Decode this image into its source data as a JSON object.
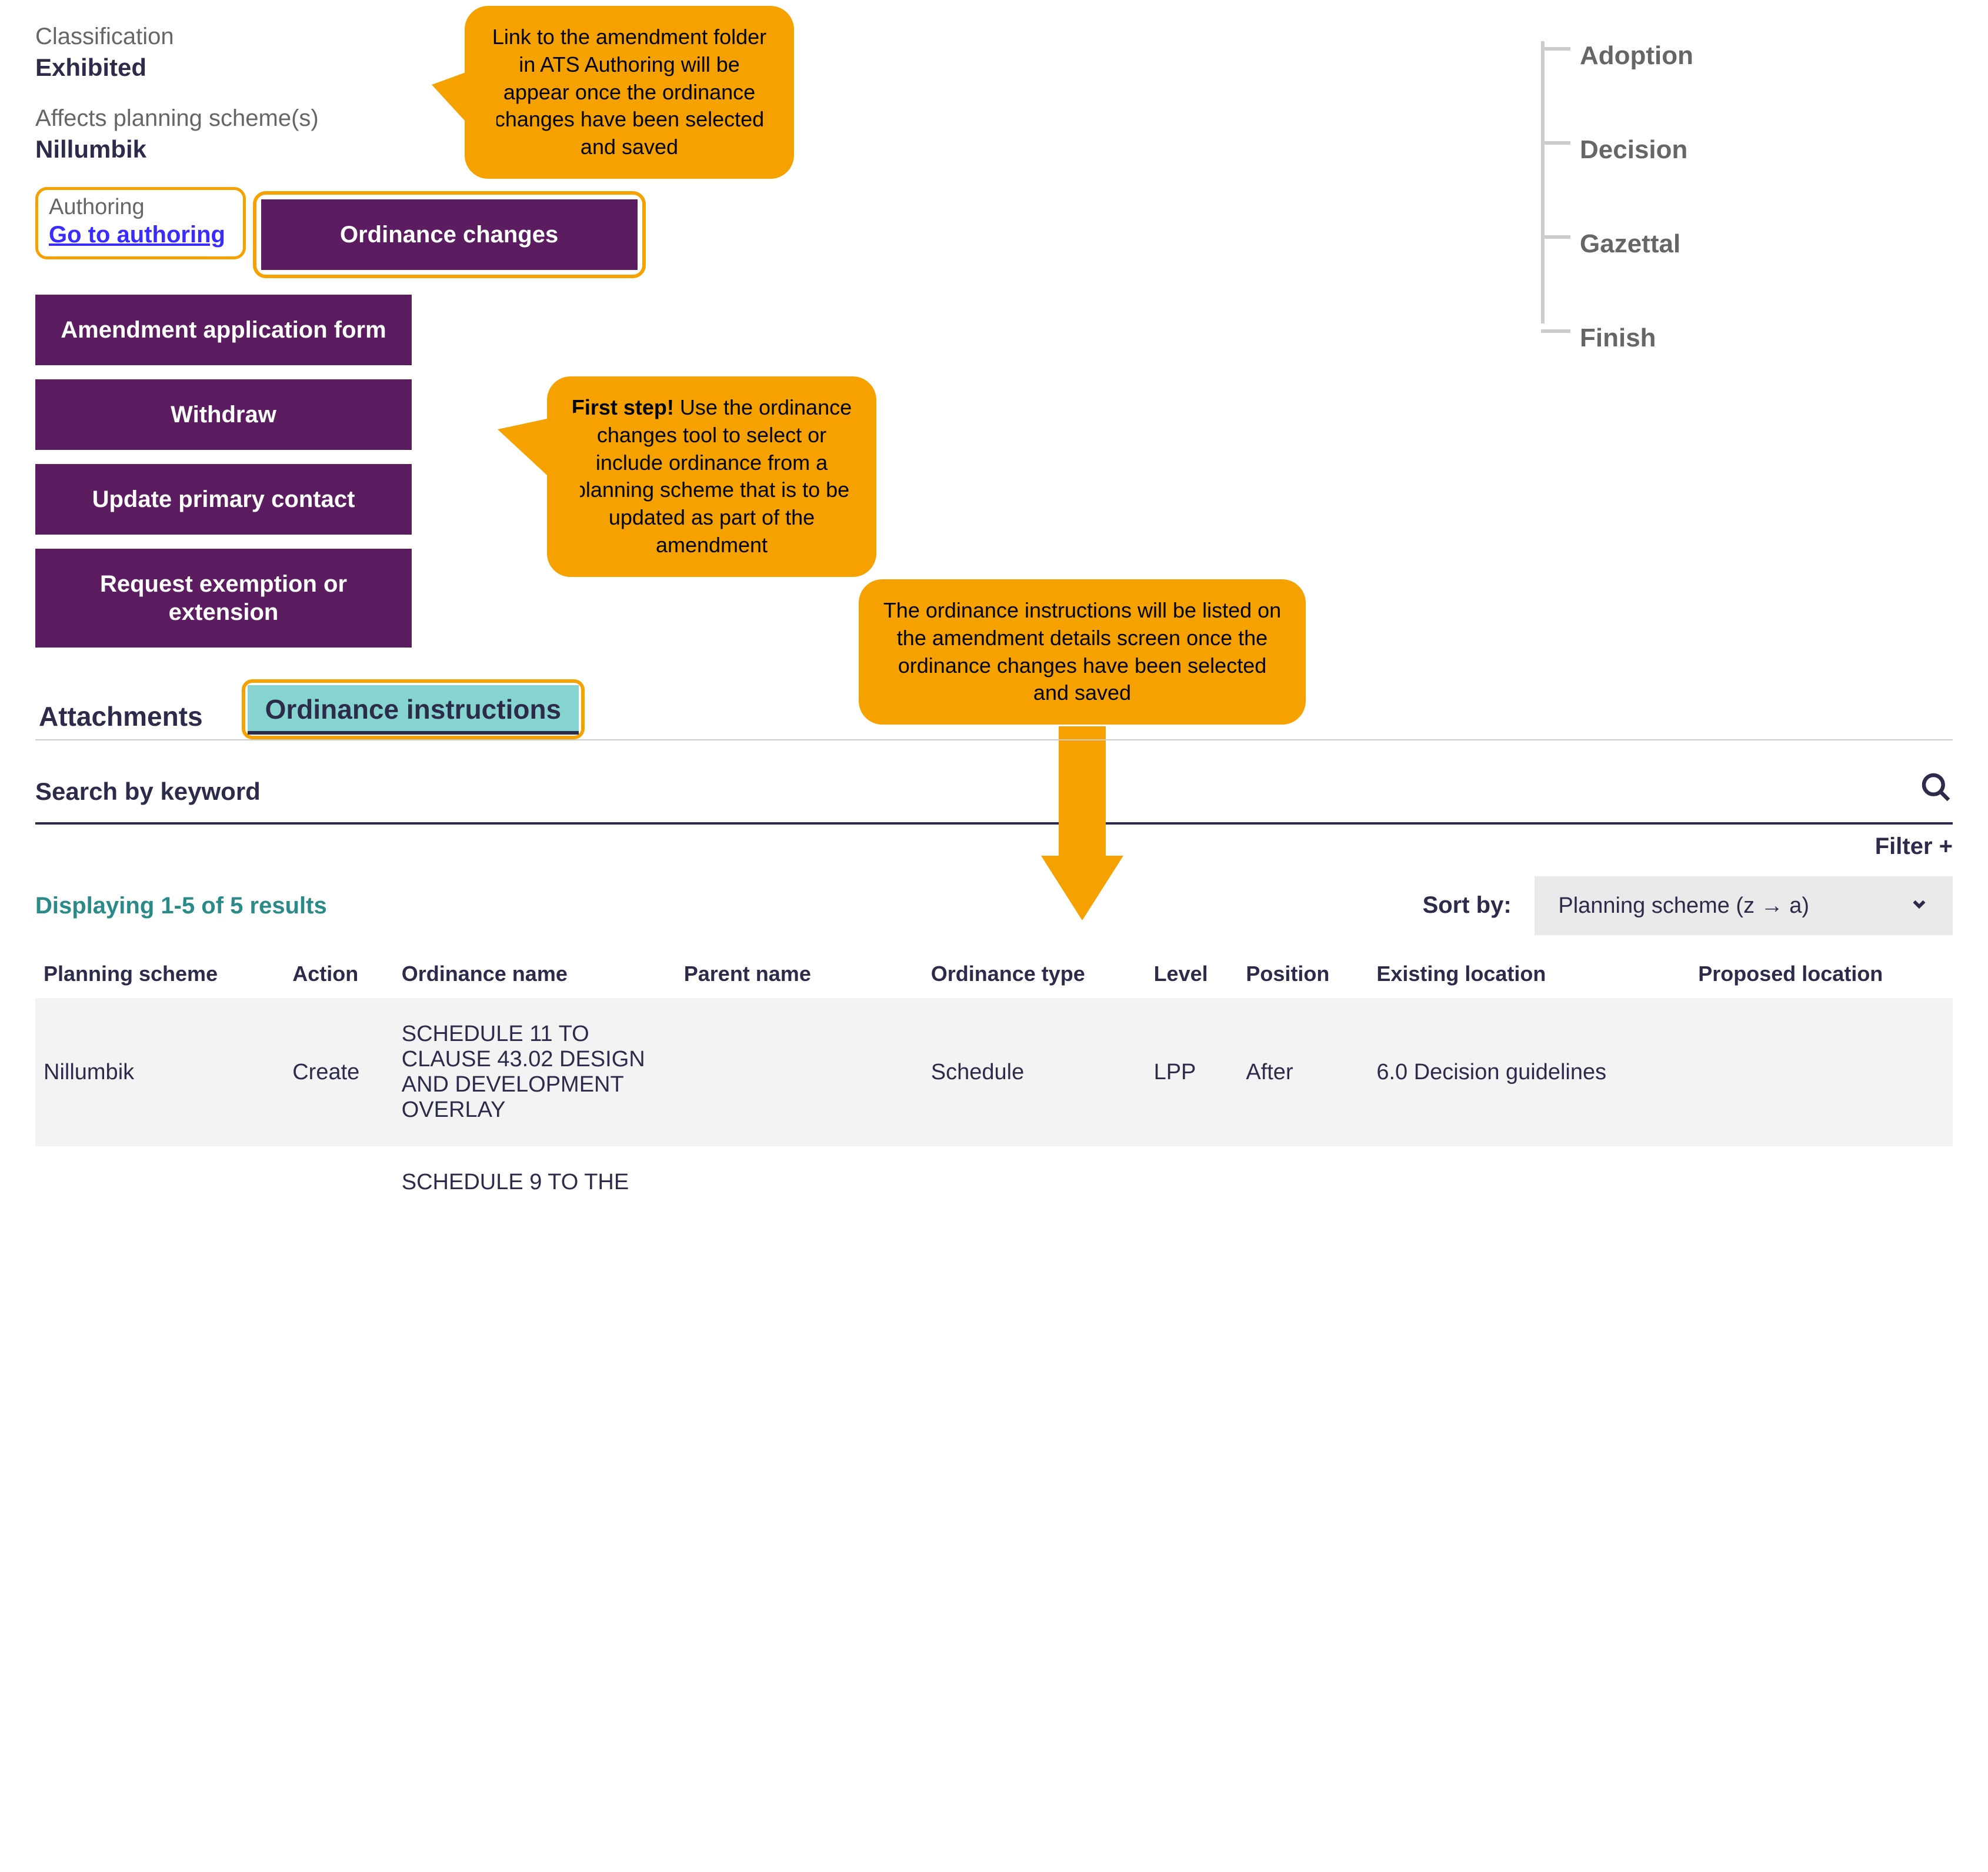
{
  "fields": {
    "classification_label": "Classification",
    "classification_value": "Exhibited",
    "affects_label": "Affects planning scheme(s)",
    "affects_value": "Nillumbik"
  },
  "authoring": {
    "label": "Authoring",
    "link": "Go to authoring"
  },
  "buttons": {
    "ordinance_changes": "Ordinance changes",
    "amendment_form": "Amendment application form",
    "withdraw": "Withdraw",
    "update_contact": "Update primary contact",
    "request_exemption": "Request exemption or extension"
  },
  "timeline": [
    "Adoption",
    "Decision",
    "Gazettal",
    "Finish"
  ],
  "callouts": {
    "authoring": "Link to the amendment folder in ATS Authoring will be appear once the ordinance changes have been selected and saved",
    "first_step_bold": "First step!",
    "first_step_rest": " Use the ordinance changes tool to select or include ordinance from a planning scheme that is to be updated as part of the amendment",
    "instructions": "The ordinance instructions will be listed on the amendment details screen once the ordinance changes have been selected and saved"
  },
  "tabs": {
    "attachments": "Attachments",
    "ordinance_instructions": "Ordinance instructions"
  },
  "search": {
    "placeholder": "Search by keyword"
  },
  "filter": "Filter +",
  "results": "Displaying 1-5 of 5 results",
  "sort": {
    "label": "Sort by:",
    "selected": "Planning scheme (z → a)"
  },
  "table": {
    "headers": {
      "scheme": "Planning scheme",
      "action": "Action",
      "ordinance_name": "Ordinance name",
      "parent_name": "Parent name",
      "ordinance_type": "Ordinance type",
      "level": "Level",
      "position": "Position",
      "existing_location": "Existing location",
      "proposed_location": "Proposed location"
    },
    "rows": [
      {
        "scheme": "Nillumbik",
        "action": "Create",
        "ordinance_name": "SCHEDULE 11 TO CLAUSE 43.02 DESIGN AND DEVELOPMENT OVERLAY",
        "parent_name": "",
        "ordinance_type": "Schedule",
        "level": "LPP",
        "position": "After",
        "existing_location": "6.0 Decision guidelines",
        "proposed_location": ""
      },
      {
        "scheme": "",
        "action": "",
        "ordinance_name": "SCHEDULE 9 TO THE",
        "parent_name": "",
        "ordinance_type": "",
        "level": "",
        "position": "",
        "existing_location": "",
        "proposed_location": ""
      }
    ]
  }
}
